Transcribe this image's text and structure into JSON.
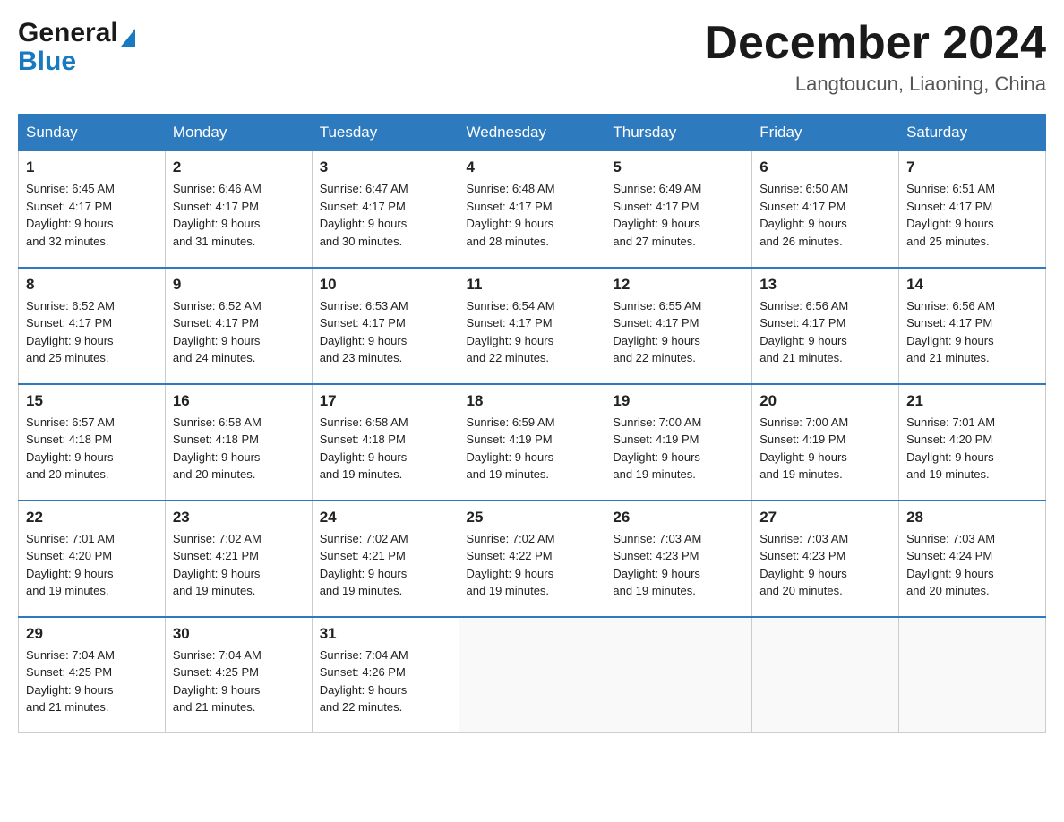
{
  "header": {
    "logo_general": "General",
    "logo_blue": "Blue",
    "month_title": "December 2024",
    "location": "Langtoucun, Liaoning, China"
  },
  "days_of_week": [
    "Sunday",
    "Monday",
    "Tuesday",
    "Wednesday",
    "Thursday",
    "Friday",
    "Saturday"
  ],
  "weeks": [
    [
      {
        "day": "1",
        "sunrise": "6:45 AM",
        "sunset": "4:17 PM",
        "daylight": "9 hours and 32 minutes."
      },
      {
        "day": "2",
        "sunrise": "6:46 AM",
        "sunset": "4:17 PM",
        "daylight": "9 hours and 31 minutes."
      },
      {
        "day": "3",
        "sunrise": "6:47 AM",
        "sunset": "4:17 PM",
        "daylight": "9 hours and 30 minutes."
      },
      {
        "day": "4",
        "sunrise": "6:48 AM",
        "sunset": "4:17 PM",
        "daylight": "9 hours and 28 minutes."
      },
      {
        "day": "5",
        "sunrise": "6:49 AM",
        "sunset": "4:17 PM",
        "daylight": "9 hours and 27 minutes."
      },
      {
        "day": "6",
        "sunrise": "6:50 AM",
        "sunset": "4:17 PM",
        "daylight": "9 hours and 26 minutes."
      },
      {
        "day": "7",
        "sunrise": "6:51 AM",
        "sunset": "4:17 PM",
        "daylight": "9 hours and 25 minutes."
      }
    ],
    [
      {
        "day": "8",
        "sunrise": "6:52 AM",
        "sunset": "4:17 PM",
        "daylight": "9 hours and 25 minutes."
      },
      {
        "day": "9",
        "sunrise": "6:52 AM",
        "sunset": "4:17 PM",
        "daylight": "9 hours and 24 minutes."
      },
      {
        "day": "10",
        "sunrise": "6:53 AM",
        "sunset": "4:17 PM",
        "daylight": "9 hours and 23 minutes."
      },
      {
        "day": "11",
        "sunrise": "6:54 AM",
        "sunset": "4:17 PM",
        "daylight": "9 hours and 22 minutes."
      },
      {
        "day": "12",
        "sunrise": "6:55 AM",
        "sunset": "4:17 PM",
        "daylight": "9 hours and 22 minutes."
      },
      {
        "day": "13",
        "sunrise": "6:56 AM",
        "sunset": "4:17 PM",
        "daylight": "9 hours and 21 minutes."
      },
      {
        "day": "14",
        "sunrise": "6:56 AM",
        "sunset": "4:17 PM",
        "daylight": "9 hours and 21 minutes."
      }
    ],
    [
      {
        "day": "15",
        "sunrise": "6:57 AM",
        "sunset": "4:18 PM",
        "daylight": "9 hours and 20 minutes."
      },
      {
        "day": "16",
        "sunrise": "6:58 AM",
        "sunset": "4:18 PM",
        "daylight": "9 hours and 20 minutes."
      },
      {
        "day": "17",
        "sunrise": "6:58 AM",
        "sunset": "4:18 PM",
        "daylight": "9 hours and 19 minutes."
      },
      {
        "day": "18",
        "sunrise": "6:59 AM",
        "sunset": "4:19 PM",
        "daylight": "9 hours and 19 minutes."
      },
      {
        "day": "19",
        "sunrise": "7:00 AM",
        "sunset": "4:19 PM",
        "daylight": "9 hours and 19 minutes."
      },
      {
        "day": "20",
        "sunrise": "7:00 AM",
        "sunset": "4:19 PM",
        "daylight": "9 hours and 19 minutes."
      },
      {
        "day": "21",
        "sunrise": "7:01 AM",
        "sunset": "4:20 PM",
        "daylight": "9 hours and 19 minutes."
      }
    ],
    [
      {
        "day": "22",
        "sunrise": "7:01 AM",
        "sunset": "4:20 PM",
        "daylight": "9 hours and 19 minutes."
      },
      {
        "day": "23",
        "sunrise": "7:02 AM",
        "sunset": "4:21 PM",
        "daylight": "9 hours and 19 minutes."
      },
      {
        "day": "24",
        "sunrise": "7:02 AM",
        "sunset": "4:21 PM",
        "daylight": "9 hours and 19 minutes."
      },
      {
        "day": "25",
        "sunrise": "7:02 AM",
        "sunset": "4:22 PM",
        "daylight": "9 hours and 19 minutes."
      },
      {
        "day": "26",
        "sunrise": "7:03 AM",
        "sunset": "4:23 PM",
        "daylight": "9 hours and 19 minutes."
      },
      {
        "day": "27",
        "sunrise": "7:03 AM",
        "sunset": "4:23 PM",
        "daylight": "9 hours and 20 minutes."
      },
      {
        "day": "28",
        "sunrise": "7:03 AM",
        "sunset": "4:24 PM",
        "daylight": "9 hours and 20 minutes."
      }
    ],
    [
      {
        "day": "29",
        "sunrise": "7:04 AM",
        "sunset": "4:25 PM",
        "daylight": "9 hours and 21 minutes."
      },
      {
        "day": "30",
        "sunrise": "7:04 AM",
        "sunset": "4:25 PM",
        "daylight": "9 hours and 21 minutes."
      },
      {
        "day": "31",
        "sunrise": "7:04 AM",
        "sunset": "4:26 PM",
        "daylight": "9 hours and 22 minutes."
      },
      null,
      null,
      null,
      null
    ]
  ],
  "labels": {
    "sunrise": "Sunrise:",
    "sunset": "Sunset:",
    "daylight": "Daylight:"
  }
}
